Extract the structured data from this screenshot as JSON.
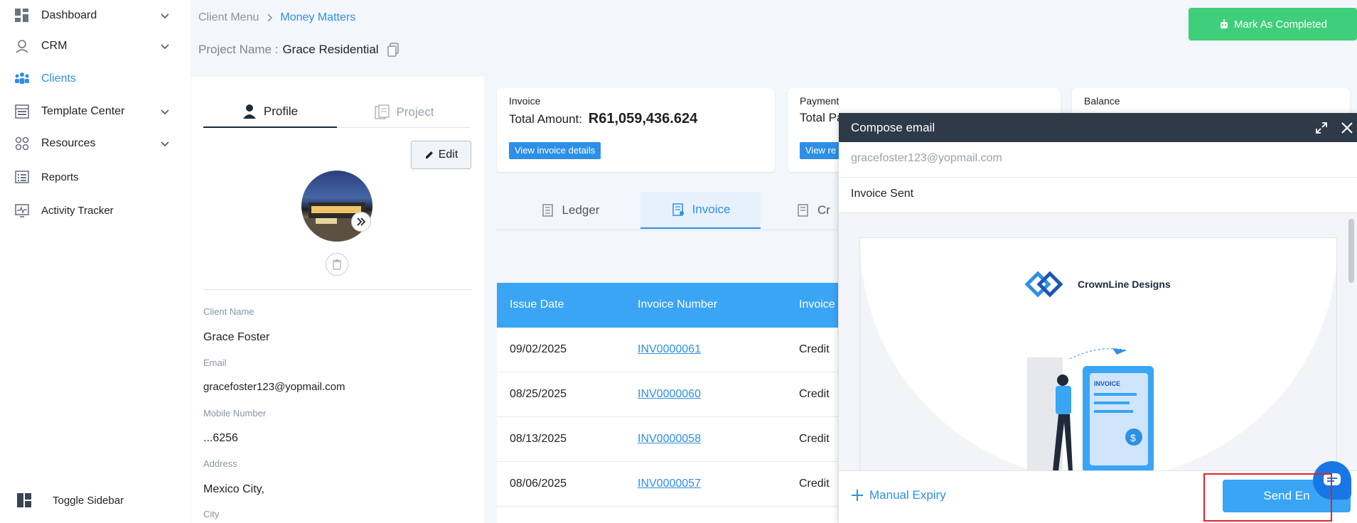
{
  "sidebar": {
    "items": [
      {
        "label": "Dashboard",
        "icon": "dashboard-icon",
        "has_chevron": true
      },
      {
        "label": "CRM",
        "icon": "crm-icon",
        "has_chevron": true
      },
      {
        "label": "Clients",
        "icon": "clients-icon",
        "has_chevron": false,
        "active": true
      },
      {
        "label": "Template Center",
        "icon": "template-icon",
        "has_chevron": true
      },
      {
        "label": "Resources",
        "icon": "resources-icon",
        "has_chevron": true
      },
      {
        "label": "Reports",
        "icon": "reports-icon",
        "has_chevron": false
      },
      {
        "label": "Activity Tracker",
        "icon": "activity-icon",
        "has_chevron": false
      }
    ],
    "toggle_label": "Toggle Sidebar"
  },
  "breadcrumb": {
    "parent": "Client Menu",
    "current": "Money Matters"
  },
  "project": {
    "label": "Project Name :",
    "value": "Grace Residential"
  },
  "actions": {
    "mark_completed": "Mark As Completed"
  },
  "profile": {
    "tabs": {
      "profile": "Profile",
      "project": "Project"
    },
    "edit_label": "Edit",
    "fields": {
      "client_name_label": "Client Name",
      "client_name": "Grace Foster",
      "email_label": "Email",
      "email": "gracefoster123@yopmail.com",
      "mobile_label": "Mobile Number",
      "mobile": "...6256",
      "address_label": "Address",
      "address": "Mexico City,",
      "city_label": "City"
    }
  },
  "cards": {
    "invoice": {
      "title": "Invoice",
      "amount_label": "Total Amount:",
      "amount": "R61,059,436.624",
      "link": "View invoice details"
    },
    "payment": {
      "title": "Payment",
      "amount_label": "Total Pa",
      "link": "View re"
    },
    "balance": {
      "title": "Balance"
    }
  },
  "tabs": {
    "ledger": "Ledger",
    "invoice": "Invoice",
    "credit": "Cr"
  },
  "table": {
    "headers": [
      "Issue Date",
      "Invoice Number",
      "Invoice"
    ],
    "rows": [
      {
        "date": "09/02/2025",
        "number": "INV0000061",
        "type": "Credit"
      },
      {
        "date": "08/25/2025",
        "number": "INV0000060",
        "type": "Credit"
      },
      {
        "date": "08/13/2025",
        "number": "INV0000058",
        "type": "Credit"
      },
      {
        "date": "08/06/2025",
        "number": "INV0000057",
        "type": "Credit"
      }
    ]
  },
  "compose": {
    "title": "Compose email",
    "to": "gracefoster123@yopmail.com",
    "subject": "Invoice Sent",
    "brand": "CrownLine Designs",
    "doc_label": "INVOICE",
    "manual_expiry": "Manual Expiry",
    "send_label": "Send En"
  },
  "colors": {
    "accent": "#2e8fe6",
    "success": "#3fce7a",
    "header_dark": "#2f3a48",
    "table_header": "#3aa4f5"
  }
}
